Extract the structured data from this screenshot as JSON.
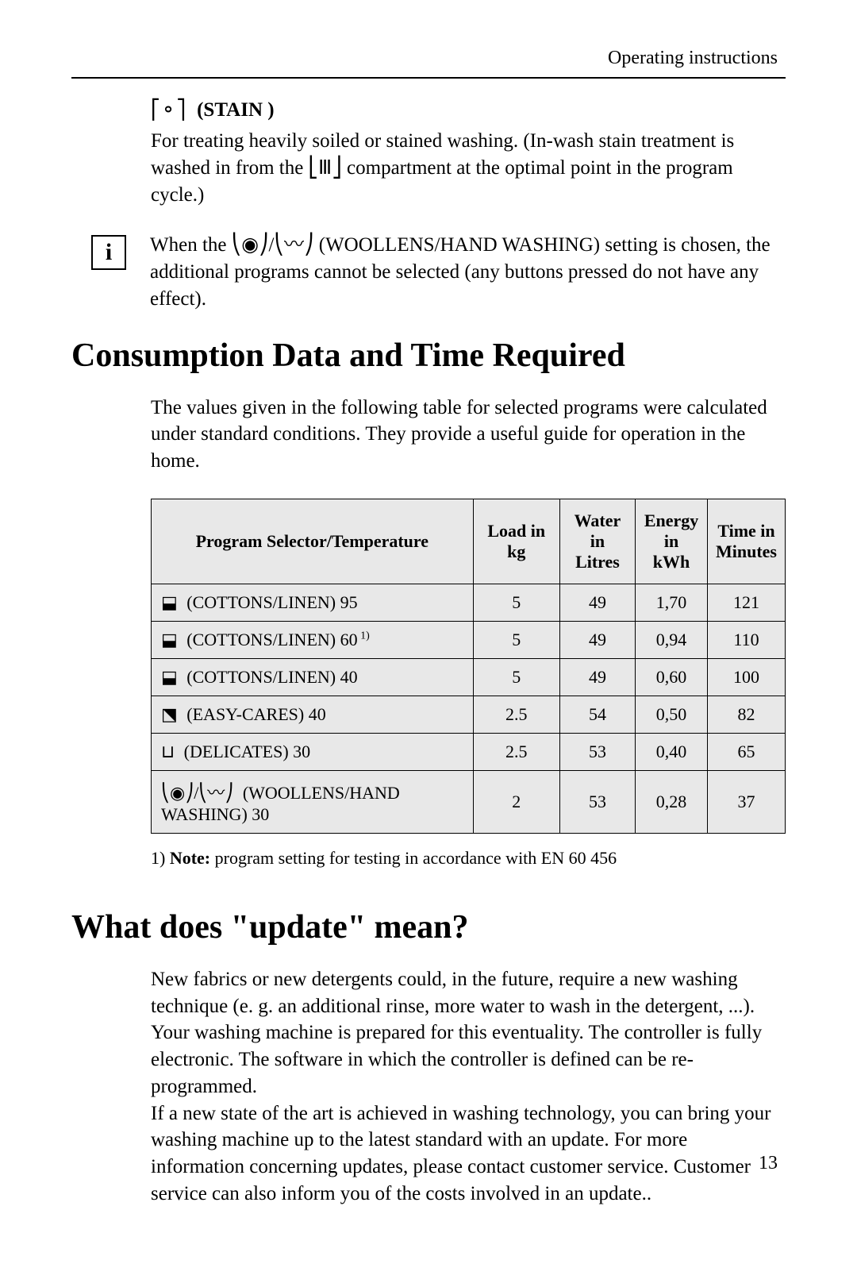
{
  "header": "Operating instructions",
  "stain": {
    "label": "(STAIN )",
    "body": "For treating heavily soiled or stained washing. (In-wash stain treatment is washed in from the ⎣Ⅲ⎦ compartment at the optimal point in the program cycle.)"
  },
  "info_icon": "i",
  "info_note": "When the ⎝◉⎠/⎝〰⎠ (WOOLLENS/HAND WASHING) setting is chosen, the additional programs cannot be selected (any buttons pressed do not have any effect).",
  "consumption": {
    "heading": "Consumption Data and Time Required",
    "intro": "The values given in the following table for selected programs were calculated under standard conditions. They provide a useful guide for operation in the home.",
    "cols": {
      "c0": "Program Selector/Temperature",
      "c1": "Load in kg",
      "c2_l1": "Water",
      "c2_l2": "in Litres",
      "c3_l1": "Energy",
      "c3_l2": "in kWh",
      "c4_l1": "Time in",
      "c4_l2": "Minutes"
    },
    "rows": [
      {
        "icon": "⬓",
        "label": "(COTTONS/LINEN) 95",
        "sup": "",
        "load": "5",
        "water": "49",
        "energy": "1,70",
        "time": "121"
      },
      {
        "icon": "⬓",
        "label": "(COTTONS/LINEN) 60",
        "sup": "1)",
        "load": "5",
        "water": "49",
        "energy": "0,94",
        "time": "110"
      },
      {
        "icon": "⬓",
        "label": "(COTTONS/LINEN) 40",
        "sup": "",
        "load": "5",
        "water": "49",
        "energy": "0,60",
        "time": "100"
      },
      {
        "icon": "⬔",
        "label": "(EASY-CARES) 40",
        "sup": "",
        "load": "2.5",
        "water": "54",
        "energy": "0,50",
        "time": "82"
      },
      {
        "icon": "⊔",
        "label": "(DELICATES) 30",
        "sup": "",
        "load": "2.5",
        "water": "53",
        "energy": "0,40",
        "time": "65"
      },
      {
        "icon": "⎝◉⎠/⎝〰⎠",
        "label": "   (WOOLLENS/HAND WASHING) 30",
        "sup": "",
        "load": "2",
        "water": "53",
        "energy": "0,28",
        "time": "37"
      }
    ],
    "footnote_prefix": "1) ",
    "footnote_bold": "Note:",
    "footnote_text": " program setting for testing in accordance with EN 60 456"
  },
  "update": {
    "heading": "What does \"update\" mean?",
    "p1": "New fabrics or new detergents could, in the future, require a new washing technique (e. g. an additional rinse, more water to wash in the detergent, ...).",
    "p2": "Your washing machine is prepared for this eventuality. The controller is fully electronic. The software in which the controller is defined can be re-programmed.",
    "p3": "If a new state of the art is achieved in washing technology, you can bring your washing machine up to the latest standard with an update. For more information concerning updates, please contact customer service. Customer service can also inform you of the costs involved in an update.."
  },
  "page_number": "13"
}
